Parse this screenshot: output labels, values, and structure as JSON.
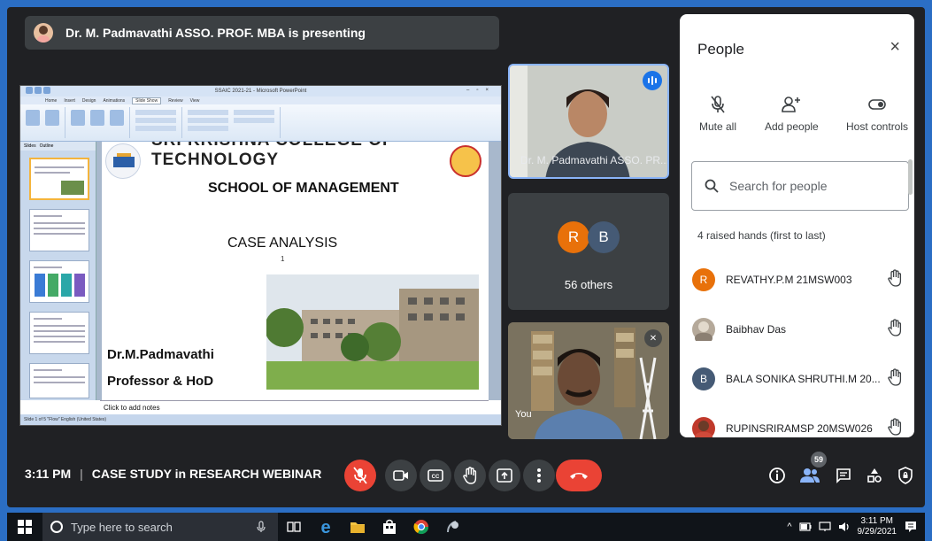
{
  "banner": {
    "text": "Dr. M. Padmavathi ASSO. PROF. MBA is presenting"
  },
  "ppt": {
    "window_title": "SSAIC 2021-21  -  Microsoft PowerPoint",
    "tabs": [
      "Home",
      "Insert",
      "Design",
      "Animations",
      "Slide Show",
      "Review",
      "View"
    ],
    "active_tab": "Slide Show",
    "side_tabs": [
      "Slides",
      "Outline"
    ],
    "slide": {
      "college": "SRI KRISHNA COLLEGE OF TECHNOLOGY",
      "school": "SCHOOL OF MANAGEMENT",
      "case": "CASE ANALYSIS",
      "number": "1",
      "presenter": "Dr.M.Padmavathi",
      "designation": "Professor & HoD"
    },
    "notes": "Click to add notes",
    "status": "Slide 1 of 5   \"Flow\"   English (United States)"
  },
  "tiles": {
    "presenter_name": "Dr. M. Padmavathi ASSO. PR...",
    "others_initials": [
      "R",
      "B"
    ],
    "others_label": "56 others",
    "you_label": "You"
  },
  "people": {
    "title": "People",
    "close": "×",
    "controls": [
      {
        "label": "Mute all",
        "icon": "mic-off-icon"
      },
      {
        "label": "Add people",
        "icon": "add-person-icon"
      },
      {
        "label": "Host controls",
        "icon": "toggle-icon"
      }
    ],
    "search_placeholder": "Search for people",
    "raised_heading": "4 raised hands (first to last)",
    "participants": [
      {
        "initial": "R",
        "name": "REVATHY.P.M 21MSW003",
        "color": "#e8710a"
      },
      {
        "initial": "",
        "name": "Baibhav Das",
        "color": "#b5a99a"
      },
      {
        "initial": "B",
        "name": "BALA SONIKA SHRUTHI.M 20...",
        "color": "#455a75"
      },
      {
        "initial": "",
        "name": "RUPINSRIRAMSP 20MSW026",
        "color": "#c0392b"
      }
    ]
  },
  "bottom": {
    "time": "3:11 PM",
    "separator": "|",
    "meeting_title": "CASE STUDY in RESEARCH WEBINAR",
    "participant_count": "59"
  },
  "taskbar": {
    "search_placeholder": "Type here to search",
    "time": "3:11 PM",
    "date": "9/29/2021"
  },
  "colors": {
    "accent": "#1a73e8",
    "danger": "#ea4335",
    "background": "#202124"
  }
}
